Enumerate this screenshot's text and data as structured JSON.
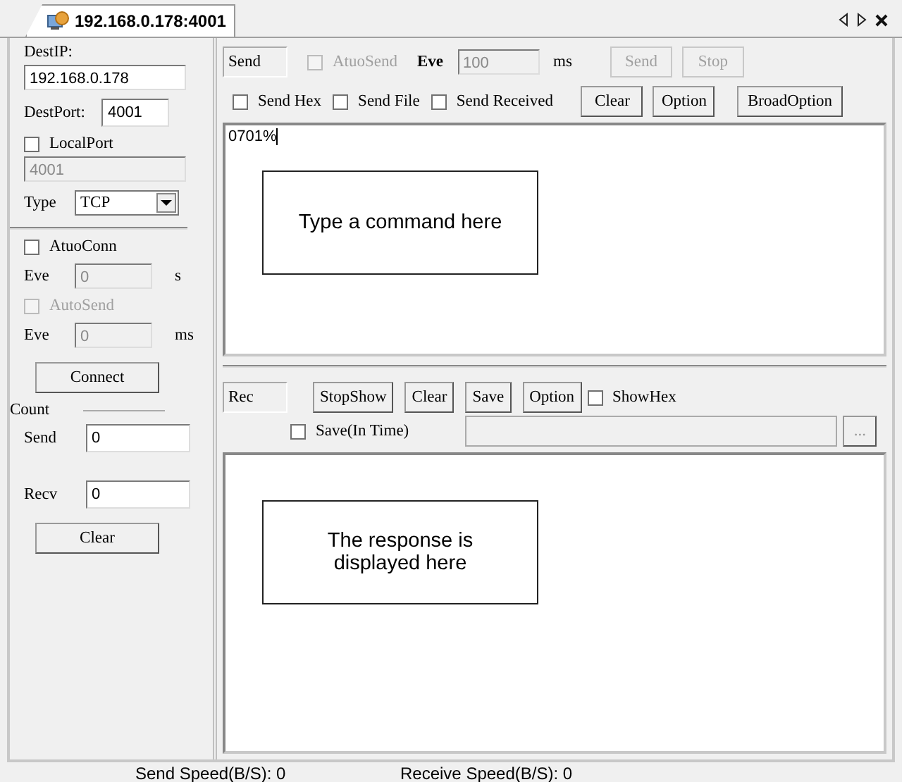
{
  "tab": {
    "label": "192.168.0.178:4001",
    "selected": true
  },
  "connection": {
    "dest_ip_label": "DestIP:",
    "dest_ip": "192.168.0.178",
    "dest_port_label": "DestPort:",
    "dest_port": "4001",
    "local_port": {
      "label": "LocalPort",
      "checked": false,
      "value": "4001"
    },
    "type_label": "Type",
    "type_value": "TCP",
    "auto_conn": {
      "label": "AtuoConn",
      "checked": false,
      "disabled": false,
      "eve_label": "Eve",
      "eve_value": "0",
      "unit": "s"
    },
    "auto_send": {
      "label": "AutoSend",
      "checked": false,
      "disabled": true,
      "eve_label": "Eve",
      "eve_value": "0",
      "unit": "ms"
    },
    "connect_button": "Connect"
  },
  "count": {
    "title": "Count",
    "send_label": "Send",
    "send_value": "0",
    "recv_label": "Recv",
    "recv_value": "0",
    "clear_button": "Clear"
  },
  "send_panel": {
    "label": "Send",
    "auto_send": {
      "label": "AtuoSend",
      "checked": false,
      "disabled": true
    },
    "eve_label": "Eve",
    "eve_value": "100",
    "unit": "ms",
    "top_buttons": [
      {
        "label": "Send",
        "disabled": true
      },
      {
        "label": "Stop",
        "disabled": true
      }
    ],
    "options": [
      {
        "label": "Send Hex",
        "checked": false
      },
      {
        "label": "Send File",
        "checked": false
      },
      {
        "label": "Send Received",
        "checked": false
      }
    ],
    "buttons": [
      {
        "label": "Clear",
        "disabled": false
      },
      {
        "label": "Option",
        "disabled": false
      }
    ],
    "broad_button": "BroadOption",
    "text": "0701%",
    "callout": "Type a command here"
  },
  "receive_panel": {
    "label": "Rec",
    "buttons": [
      {
        "label": "StopShow"
      },
      {
        "label": "Clear"
      },
      {
        "label": "Save"
      },
      {
        "label": "Option"
      }
    ],
    "show_hex": {
      "label": "ShowHex",
      "checked": false
    },
    "save_in_time": {
      "label": "Save(In Time)",
      "checked": false
    },
    "browse_button": "...",
    "callout": "The response is displayed here"
  },
  "status_bar": [
    "Send Speed(B/S): 0",
    "Receive Speed(B/S): 0"
  ]
}
